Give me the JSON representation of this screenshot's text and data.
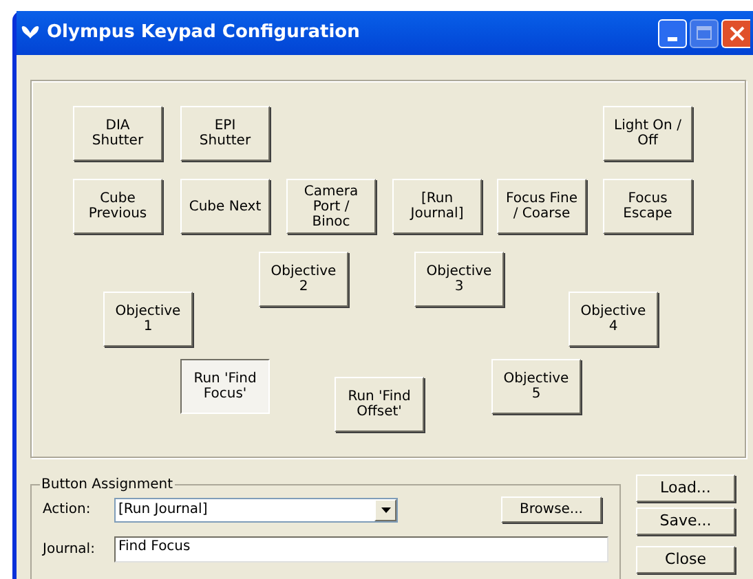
{
  "window": {
    "title": "Olympus Keypad Configuration"
  },
  "keypad": [
    {
      "label": "DIA\nShutter",
      "selected": false
    },
    {
      "label": "EPI\nShutter",
      "selected": false
    },
    {
      "label": "Light On /\nOff",
      "selected": false
    },
    {
      "label": "Cube\nPrevious",
      "selected": false
    },
    {
      "label": "Cube Next",
      "selected": false
    },
    {
      "label": "Camera\nPort /\nBinoc",
      "selected": false
    },
    {
      "label": "[Run\nJournal]",
      "selected": false
    },
    {
      "label": "Focus Fine\n/ Coarse",
      "selected": false
    },
    {
      "label": "Focus\nEscape",
      "selected": false
    },
    {
      "label": "Objective\n2",
      "selected": false
    },
    {
      "label": "Objective\n3",
      "selected": false
    },
    {
      "label": "Objective\n1",
      "selected": false
    },
    {
      "label": "Objective\n4",
      "selected": false
    },
    {
      "label": "Run 'Find\nFocus'",
      "selected": true
    },
    {
      "label": "Run 'Find\nOffset'",
      "selected": false
    },
    {
      "label": "Objective\n5",
      "selected": false
    }
  ],
  "assignment": {
    "title": "Button Assignment",
    "action_label": "Action:",
    "action_value": "[Run Journal]",
    "browse": "Browse...",
    "journal_label": "Journal:",
    "journal_value": "Find Focus"
  },
  "side_buttons": [
    "Load...",
    "Save...",
    "Close"
  ]
}
